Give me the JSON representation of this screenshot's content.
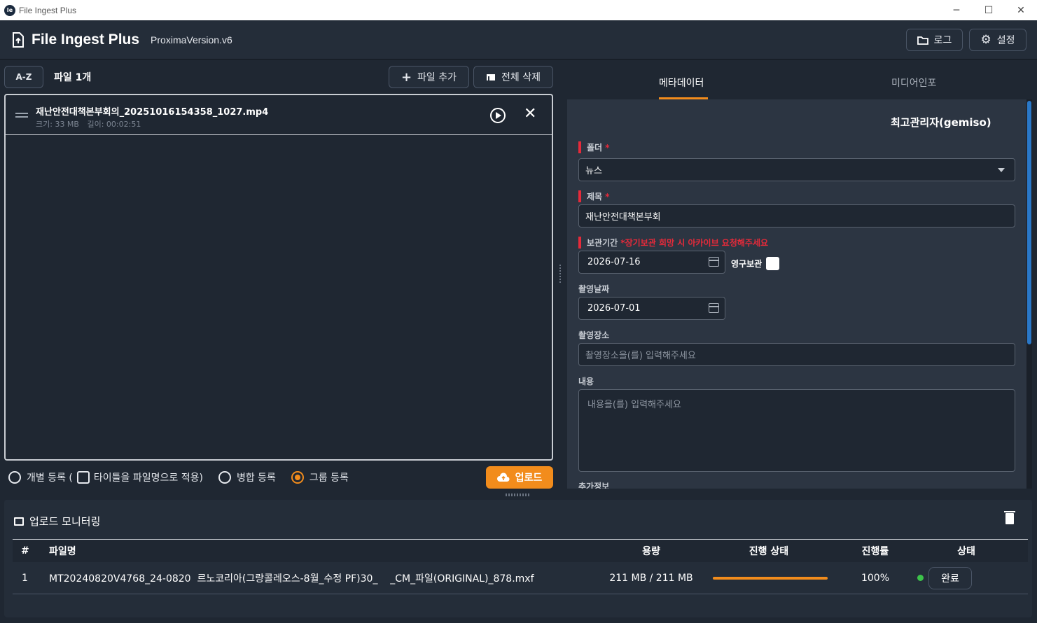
{
  "window": {
    "title": "File Ingest Plus",
    "minimize": "─",
    "maximize": "☐",
    "close": "✕"
  },
  "header": {
    "app_title": "File Ingest Plus",
    "version": "ProximaVersion.v6",
    "log_label": "로그",
    "settings_label": "설정"
  },
  "toolbar": {
    "sort_label": "A-Z",
    "file_count": "파일 1개",
    "add_file_label": "파일 추가",
    "delete_all_label": "전체 삭제"
  },
  "files": [
    {
      "name": "재난안전대책본부회의_20251016154358_1027.mp4",
      "size": "크기: 33 MB",
      "duration": "길이: 00:02:51"
    }
  ],
  "register": {
    "individual": "개별 등록 (",
    "title_as_filename": "타이틀을 파일명으로 적용)",
    "merge": "병합 등록",
    "group": "그룹 등록",
    "selected": "group",
    "upload_label": "업로드"
  },
  "tabs": {
    "metadata": "메타데이터",
    "mediainfo": "미디어인포",
    "active": "metadata"
  },
  "meta": {
    "user": "최고관리자(gemiso)",
    "folder_label": "폴더",
    "folder_value": "뉴스",
    "title_label": "제목",
    "title_value": "재난안전대책본부회",
    "retention_label": "보관기간",
    "retention_note": "*장기보관 희망 시 아카이브 요청해주세요",
    "retention_date": "2026-07-16",
    "permanent_label": "영구보관",
    "shoot_date_label": "촬영날짜",
    "shoot_date": "2026-07-01",
    "location_label": "촬영장소",
    "location_placeholder": "촬영장소을(를) 입력해주세요",
    "content_label": "내용",
    "content_placeholder": "내용을(를) 입력해주세요",
    "extra_label": "추가정보"
  },
  "monitor": {
    "title": "업로드 모니터링",
    "columns": [
      "#",
      "파일명",
      "용량",
      "진행 상태",
      "진행률",
      "상태"
    ],
    "rows": [
      {
        "index": "1",
        "filename": "MT20240820V4768_24-0820  르노코리아(그랑콜레오스-8월_수정 PF)30_    _CM_파일(ORIGINAL)_878.mxf",
        "size": "211 MB / 211 MB",
        "progress": 1.0,
        "percent": "100%",
        "status": "완료"
      }
    ]
  },
  "colors": {
    "accent": "#f28c1c",
    "required": "#e52a3a",
    "success": "#3cc34a",
    "scroll": "#2a78c8"
  }
}
